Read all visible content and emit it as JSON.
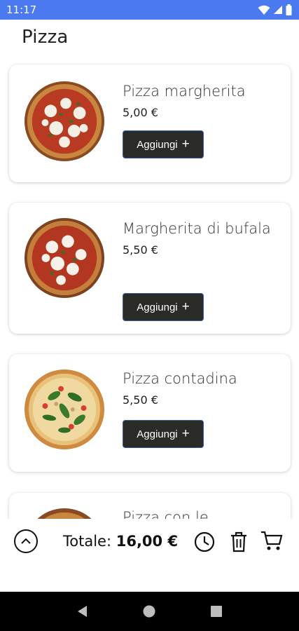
{
  "status_bar": {
    "time": "11:17"
  },
  "header": {
    "title": "Pizza"
  },
  "menu": {
    "items": [
      {
        "name": "Pizza margherita",
        "price": "5,00 €",
        "add_label": "Aggiungi"
      },
      {
        "name": "Margherita di bufala",
        "price": "5,50 €",
        "add_label": "Aggiungi"
      },
      {
        "name": "Pizza contadina",
        "price": "5,50 €",
        "add_label": "Aggiungi"
      },
      {
        "name": "Pizza con le"
      }
    ]
  },
  "cart_bar": {
    "total_label": "Totale:",
    "total_value": "16,00 €",
    "icons": [
      "chevron-up-icon",
      "clock-icon",
      "trash-icon",
      "cart-icon"
    ]
  },
  "nav": {
    "icons": [
      "back-icon",
      "home-icon",
      "recents-icon"
    ]
  },
  "colors": {
    "status_bar": "#4a79f0",
    "button": "#2a2a26",
    "nav_bar": "#000000"
  }
}
